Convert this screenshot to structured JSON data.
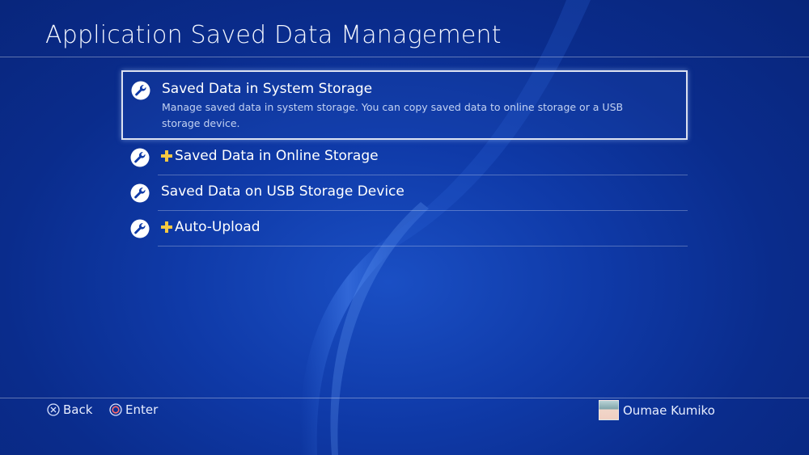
{
  "page": {
    "title": "Application Saved Data Management"
  },
  "menu": {
    "items": [
      {
        "label": "Saved Data in System Storage",
        "description": "Manage saved data in system storage. You can copy saved data to online storage or a USB storage device.",
        "plus": false,
        "selected": true,
        "icon": "wrench-icon"
      },
      {
        "label": "Saved Data in Online Storage",
        "plus": true,
        "selected": false,
        "icon": "wrench-icon"
      },
      {
        "label": "Saved Data on USB Storage Device",
        "plus": false,
        "selected": false,
        "icon": "wrench-icon"
      },
      {
        "label": "Auto-Upload",
        "plus": true,
        "selected": false,
        "icon": "wrench-icon"
      }
    ]
  },
  "footer": {
    "back_label": "Back",
    "enter_label": "Enter",
    "user_name": "Oumae Kumiko"
  },
  "colors": {
    "background": "#0f3aa8",
    "plus_gold": "#f5c842",
    "text": "#ffffff"
  }
}
